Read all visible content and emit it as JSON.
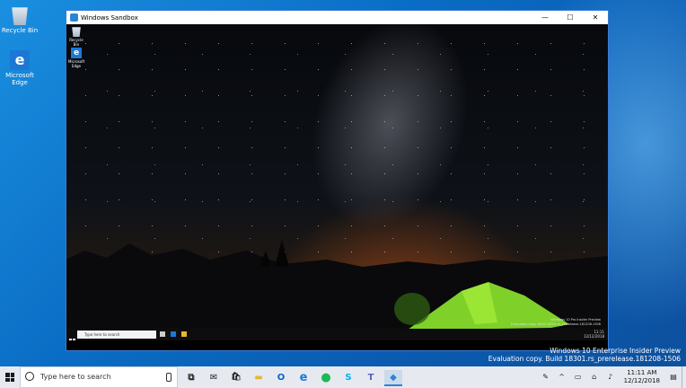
{
  "desktop": {
    "icons": [
      {
        "label": "Recycle Bin",
        "icon": "recycle-bin-icon"
      },
      {
        "label": "Microsoft Edge",
        "icon": "edge-icon"
      }
    ],
    "watermark": {
      "line1": "Windows 10 Enterprise Insider Preview",
      "line2": "Evaluation copy. Build 18301.rs_prerelease.181208-1506"
    }
  },
  "sandbox_window": {
    "title": "Windows Sandbox",
    "controls": {
      "minimize": "—",
      "maximize": "☐",
      "close": "✕"
    },
    "inner_desktop": {
      "icons": [
        {
          "label": "Recycle Bin",
          "icon": "recycle-bin-icon"
        },
        {
          "label": "Microsoft Edge",
          "icon": "edge-icon"
        }
      ],
      "watermark_line1": "Windows 10 Pro Insider Preview",
      "watermark_line2": "Evaluation copy. Build 18301.rs_prerelease.181208-1506",
      "taskbar": {
        "search_placeholder": "Type here to search",
        "time": "11:11",
        "date": "12/12/2018"
      }
    }
  },
  "taskbar": {
    "search_placeholder": "Type here to search",
    "pinned": [
      {
        "name": "task-view",
        "glyph": "⧉",
        "color": "#222222"
      },
      {
        "name": "mail",
        "glyph": "✉",
        "color": "#222222"
      },
      {
        "name": "store",
        "glyph": "🛍",
        "color": "#222222"
      },
      {
        "name": "file-explorer",
        "glyph": "▬",
        "color": "#e8b731"
      },
      {
        "name": "outlook",
        "glyph": "O",
        "color": "#0a64c2"
      },
      {
        "name": "edge",
        "glyph": "e",
        "color": "#1c78d4"
      },
      {
        "name": "spotify",
        "glyph": "●",
        "color": "#1db954"
      },
      {
        "name": "skype",
        "glyph": "S",
        "color": "#00aff0"
      },
      {
        "name": "teams",
        "glyph": "T",
        "color": "#5b5fc7"
      },
      {
        "name": "windows-sandbox",
        "glyph": "◆",
        "color": "#2b83d6"
      }
    ],
    "time": "11:11 AM",
    "date": "12/12/2018"
  },
  "colors": {
    "accent": "#2b83d6",
    "desktop": "#0a6cc4",
    "tent": "#8ee02a"
  }
}
